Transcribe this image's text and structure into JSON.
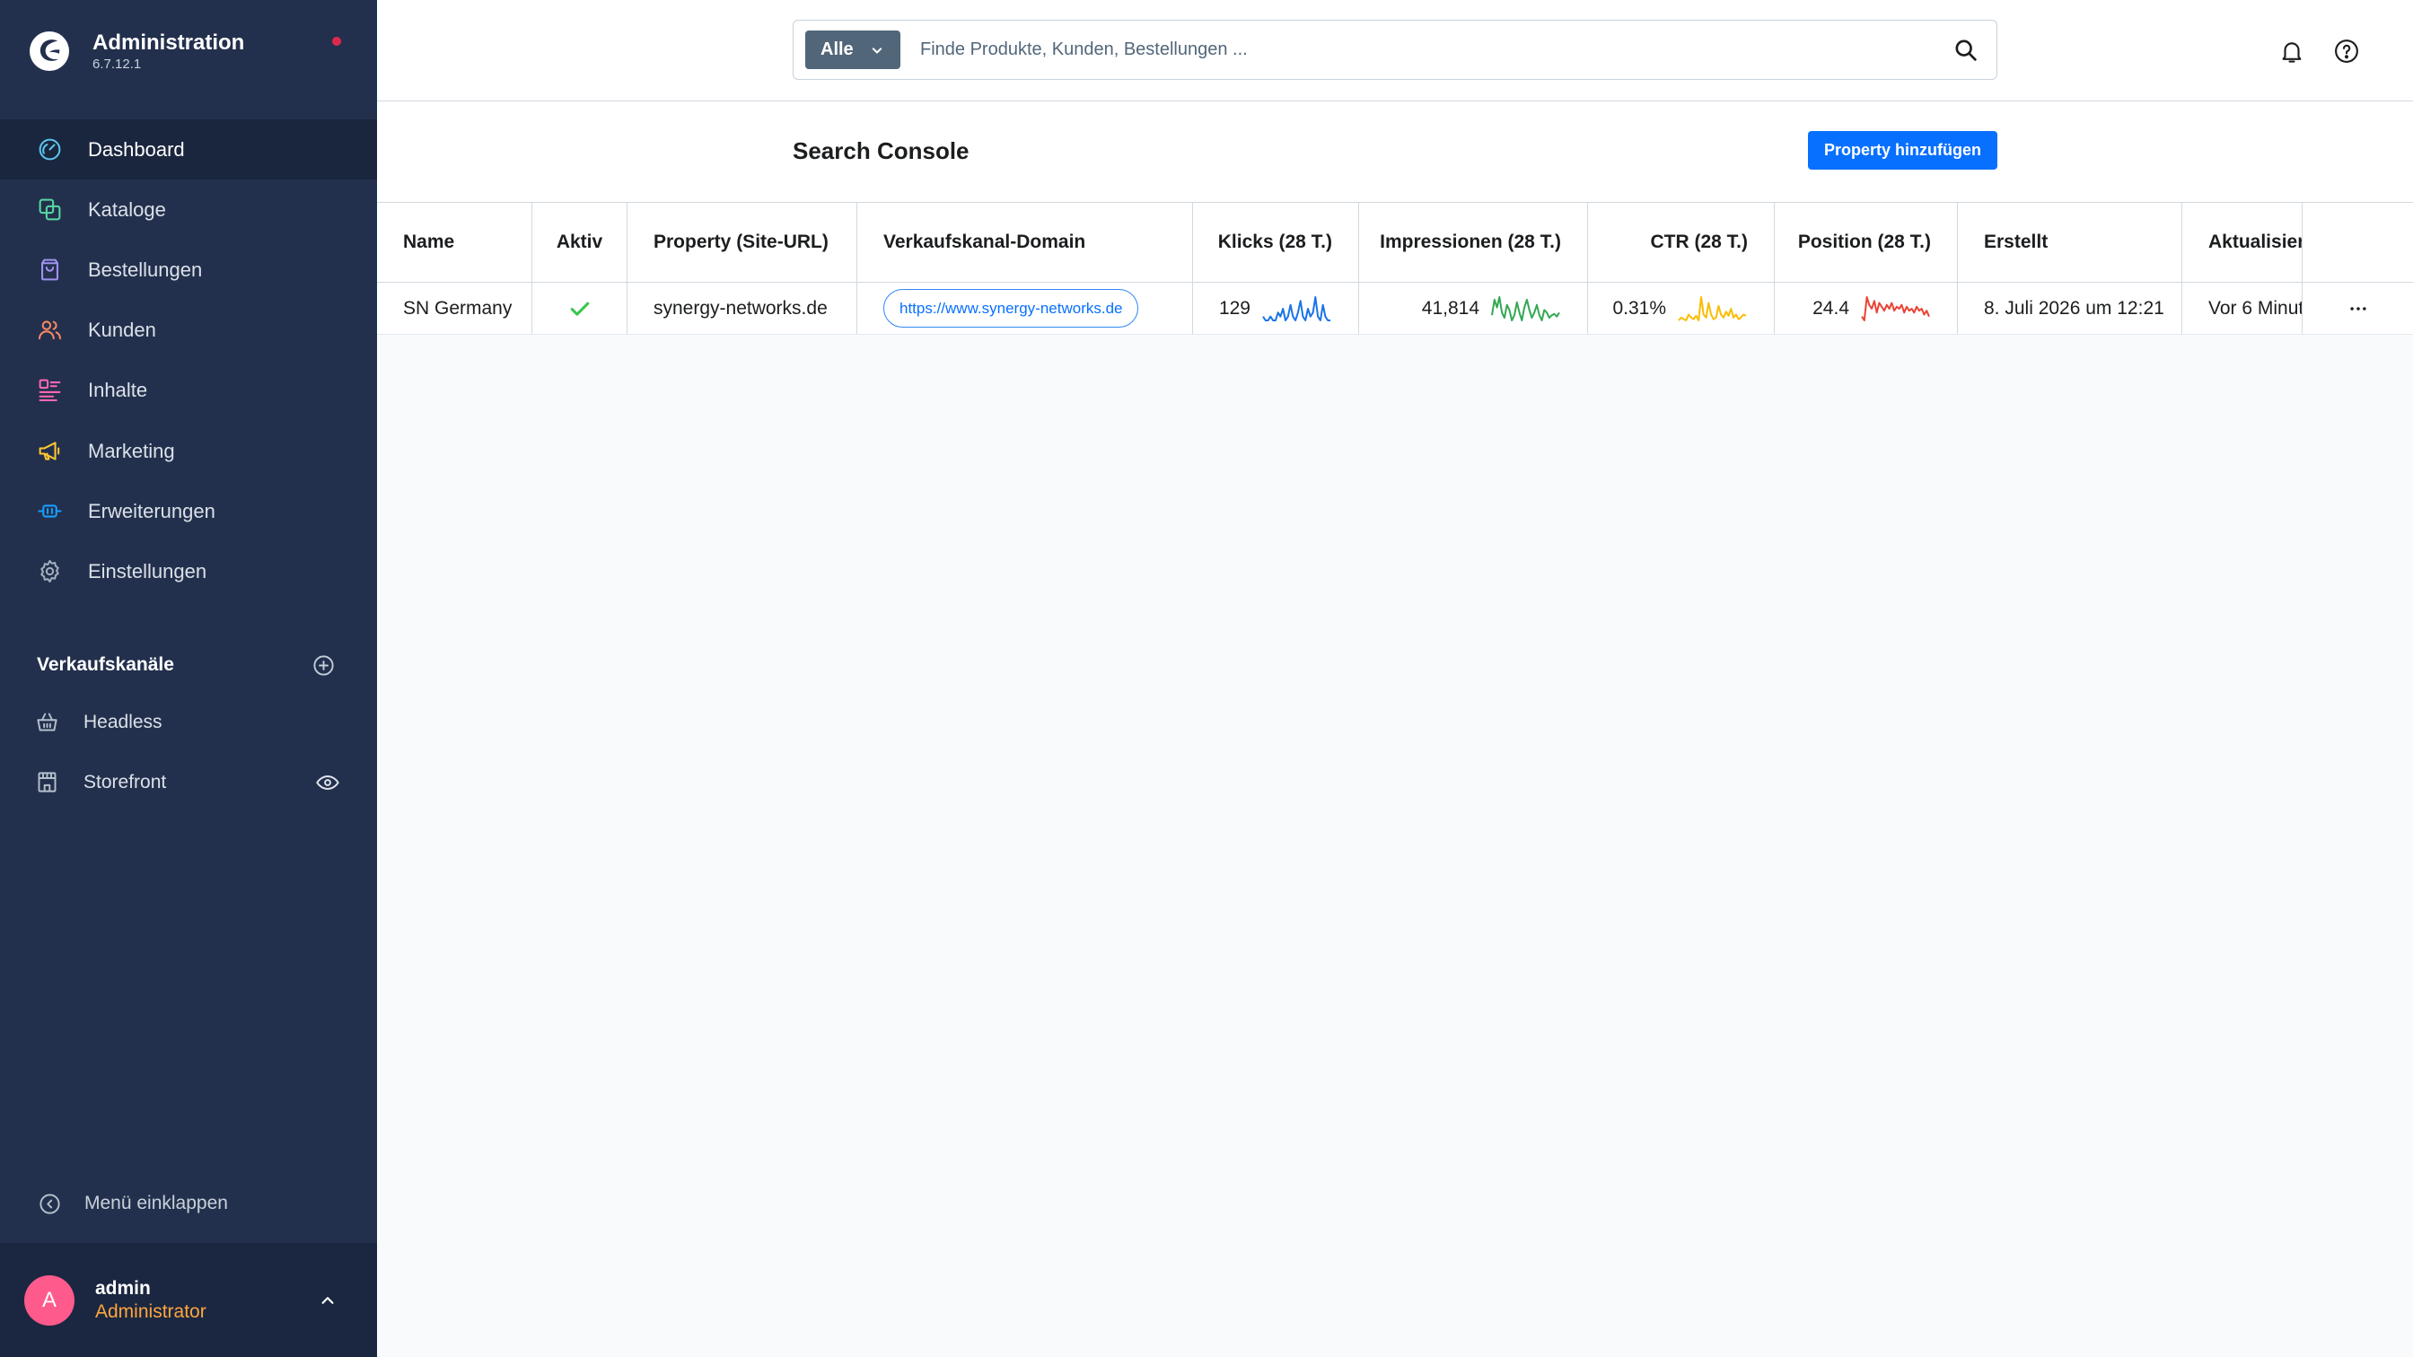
{
  "app": {
    "title": "Administration",
    "version": "6.7.12.1",
    "logo_icon": "shopware-logo-icon",
    "notification_color": "#de294c"
  },
  "sidebar": {
    "nav": [
      {
        "label": "Dashboard",
        "icon": "dashboard-icon",
        "color": "#5bc6ea",
        "active": true
      },
      {
        "label": "Kataloge",
        "icon": "catalog-icon",
        "color": "#57d9a3"
      },
      {
        "label": "Bestellungen",
        "icon": "shopping-bag-icon",
        "color": "#a092f0"
      },
      {
        "label": "Kunden",
        "icon": "users-icon",
        "color": "#f88962"
      },
      {
        "label": "Inhalte",
        "icon": "content-list-icon",
        "color": "#ff68b4"
      },
      {
        "label": "Marketing",
        "icon": "megaphone-icon",
        "color": "#ffc730"
      },
      {
        "label": "Erweiterungen",
        "icon": "plug-icon",
        "color": "#189eff"
      },
      {
        "label": "Einstellungen",
        "icon": "gear-icon",
        "color": "#a3afbc"
      }
    ],
    "sales_channels": {
      "heading": "Verkaufskanäle",
      "add_icon": "plus-circle-icon",
      "items": [
        {
          "label": "Headless",
          "icon": "basket-icon"
        },
        {
          "label": "Storefront",
          "icon": "storefront-icon",
          "action_icon": "eye-icon"
        }
      ]
    },
    "collapse": {
      "label": "Menü einklappen",
      "icon": "chevron-left-circle-icon"
    },
    "user": {
      "initial": "A",
      "name": "admin",
      "role": "Administrator",
      "avatar_color": "#ff5a8c",
      "role_color": "#ffa63d",
      "toggle_icon": "chevron-up-icon"
    }
  },
  "search": {
    "scope": "Alle",
    "scope_icon": "chevron-down-icon",
    "placeholder": "Finde Produkte, Kunden, Bestellungen ...",
    "icon": "search-icon"
  },
  "header_icons": [
    "bell-icon",
    "help-icon"
  ],
  "page": {
    "title": "Search Console",
    "add_button": "Property hinzufügen",
    "accent": "#0870ff"
  },
  "table": {
    "columns": [
      "Name",
      "Aktiv",
      "Property (Site-URL)",
      "Verkaufskanal-Domain",
      "Klicks (28 T.)",
      "Impressionen (28 T.)",
      "CTR (28 T.)",
      "Position (28 T.)",
      "Erstellt",
      "Aktualisier"
    ],
    "trend_colors": {
      "clicks": "#1a73e8",
      "impressions": "#34a853",
      "ctr": "#fbbc04",
      "position": "#ea4335"
    },
    "rows": [
      {
        "name": "SN Germany",
        "active": true,
        "active_icon": "check-icon",
        "property": "synergy-networks.de",
        "domain": "https://www.synergy-networks.de",
        "clicks": "129",
        "impressions": "41,814",
        "ctr": "0.31%",
        "position": "24.4",
        "created": "8. Juli 2026 um 12:21",
        "updated": "Vor 6 Minut",
        "actions_icon": "more-icon",
        "trends": {
          "clicks": [
            3,
            2,
            2,
            3,
            2,
            2,
            4,
            3,
            5,
            2,
            3,
            6,
            3,
            2,
            4,
            7,
            3,
            2,
            5,
            3,
            4,
            8,
            3,
            2,
            6,
            3,
            2,
            2
          ],
          "impressions": [
            1200,
            1800,
            1500,
            1900,
            1300,
            1100,
            1600,
            1400,
            1000,
            1200,
            1700,
            1300,
            1000,
            1500,
            1800,
            1400,
            1100,
            1300,
            1600,
            1200,
            1000,
            1400,
            1300,
            1100,
            1200,
            1250,
            1150,
            1300
          ],
          "ctr": [
            0.2,
            0.25,
            0.22,
            0.2,
            0.3,
            0.25,
            0.22,
            0.28,
            0.2,
            0.6,
            0.3,
            0.25,
            0.5,
            0.3,
            0.22,
            0.25,
            0.45,
            0.3,
            0.25,
            0.35,
            0.28,
            0.4,
            0.25,
            0.3,
            0.22,
            0.25,
            0.3,
            0.28
          ],
          "position": [
            20,
            18,
            30,
            26,
            24,
            28,
            22,
            27,
            25,
            23,
            26,
            24,
            27,
            23,
            25,
            24,
            26,
            22,
            25,
            23,
            24,
            22,
            25,
            23,
            24,
            21,
            23,
            20
          ]
        }
      }
    ]
  }
}
